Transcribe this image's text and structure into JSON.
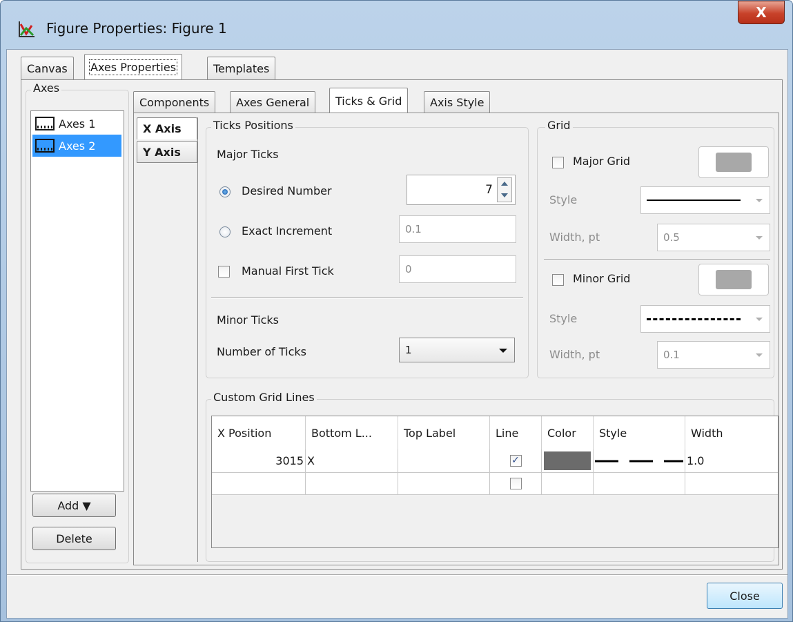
{
  "window": {
    "title": "Figure Properties: Figure 1",
    "close_glyph": "X"
  },
  "top_tabs": [
    "Canvas",
    "Axes Properties",
    "Templates"
  ],
  "axes_list": {
    "label": "Axes",
    "items": [
      "Axes 1",
      "Axes 2"
    ],
    "selected": "Axes 2"
  },
  "sub_tabs": [
    "Components",
    "Axes General",
    "Ticks & Grid",
    "Axis Style"
  ],
  "axis_tabs": [
    "X Axis",
    "Y Axis"
  ],
  "ticks": {
    "group_label": "Ticks Positions",
    "major_label": "Major Ticks",
    "desired_number_label": "Desired Number",
    "desired_number_value": "7",
    "exact_increment_label": "Exact Increment",
    "exact_increment_value": "0.1",
    "manual_first_tick_label": "Manual First Tick",
    "manual_first_tick_value": "0",
    "minor_label": "Minor Ticks",
    "number_of_ticks_label": "Number of Ticks",
    "number_of_ticks_value": "1"
  },
  "grid": {
    "group_label": "Grid",
    "major_grid_label": "Major Grid",
    "minor_grid_label": "Minor Grid",
    "style_label": "Style",
    "width_label": "Width, pt",
    "major_width": "0.5",
    "minor_width": "0.1",
    "swatch_color": "#a8a8a8"
  },
  "custom_grid": {
    "group_label": "Custom Grid Lines",
    "columns": [
      "X Position",
      "Bottom L...",
      "Top Label",
      "Line",
      "Color",
      "Style",
      "Width"
    ],
    "rows": [
      {
        "x_position": "3015",
        "bottom_label": "X",
        "top_label": "",
        "line_checked": true,
        "color": "#6b6b6b",
        "width": "1.0"
      },
      {
        "x_position": "",
        "bottom_label": "",
        "top_label": "",
        "line_checked": false,
        "color": "",
        "width": ""
      }
    ]
  },
  "buttons": {
    "add": "Add ▼",
    "delete": "Delete",
    "close": "Close"
  }
}
